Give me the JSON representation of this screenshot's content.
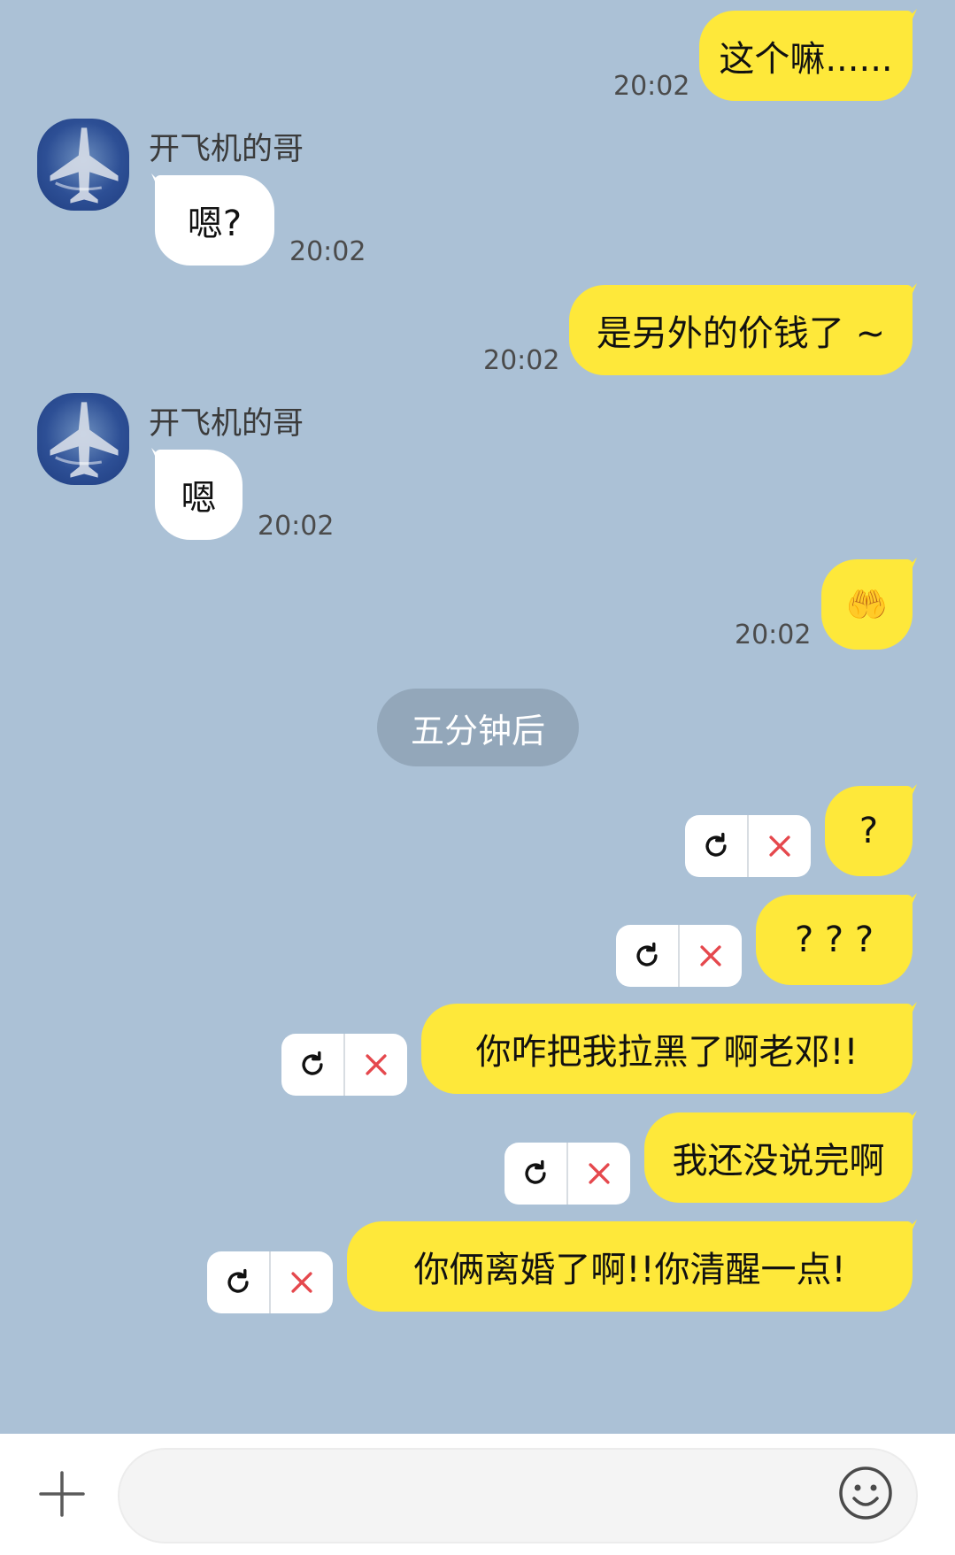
{
  "contact": {
    "name": "开飞机的哥"
  },
  "messages": [
    {
      "dir": "out",
      "text": "这个嘛......",
      "time": "20:02"
    },
    {
      "dir": "in",
      "sender": "开飞机的哥",
      "text": "嗯?",
      "time": "20:02"
    },
    {
      "dir": "out",
      "text": "是另外的价钱了 ~",
      "time": "20:02"
    },
    {
      "dir": "in",
      "sender": "开飞机的哥",
      "text": "嗯",
      "time": "20:02"
    },
    {
      "dir": "out",
      "text": "🤲",
      "time": "20:02"
    }
  ],
  "divider": {
    "text": "五分钟后"
  },
  "failed_messages": [
    {
      "text": "?"
    },
    {
      "text": "? ? ?"
    },
    {
      "text": "你咋把我拉黑了啊老邓!!"
    },
    {
      "text": "我还没说完啊"
    },
    {
      "text": "你俩离婚了啊!!你清醒一点!"
    }
  ],
  "composer": {
    "value": "",
    "placeholder": ""
  },
  "icons": {
    "resend": "refresh-icon",
    "delete": "close-icon",
    "attach": "plus-icon",
    "emoji": "smiley-icon"
  },
  "colors": {
    "background": "#abc1d6",
    "outgoing_bubble": "#fee83a",
    "incoming_bubble": "#ffffff",
    "divider": "#93a7ba",
    "delete_icon": "#e5484d"
  }
}
